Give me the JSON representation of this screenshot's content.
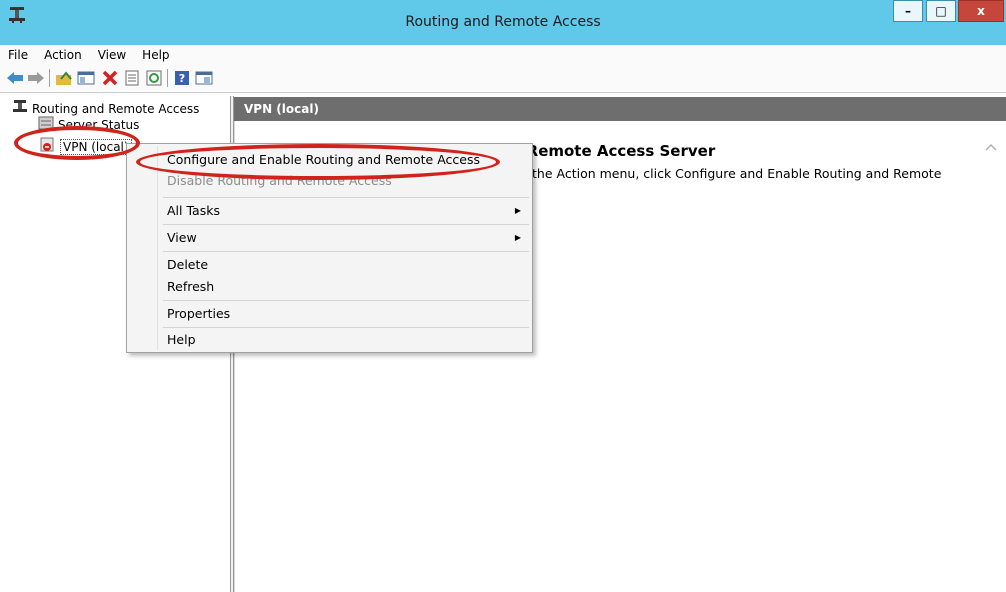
{
  "window": {
    "title": "Routing and Remote Access",
    "controls": {
      "minimize": "–",
      "maximize": "□",
      "close": "x"
    }
  },
  "menubar": {
    "items": [
      "File",
      "Action",
      "View",
      "Help"
    ]
  },
  "toolbar": {
    "icons": [
      "back-icon",
      "forward-icon",
      "up-folder-icon",
      "show-hide-tree-icon",
      "delete-icon",
      "properties-icon",
      "refresh-icon",
      "help-icon",
      "console-icon"
    ]
  },
  "tree": {
    "root": "Routing and Remote Access",
    "items": [
      "Server Status",
      "VPN (local)"
    ]
  },
  "content": {
    "header": "VPN (local)",
    "heading_partial": "nd Remote Access Server",
    "text_partial": "the Action menu, click Configure and Enable Routing and Remote"
  },
  "context_menu": {
    "items": [
      {
        "label": "Configure and Enable Routing and Remote Access",
        "enabled": true
      },
      {
        "label": "Disable Routing and Remote Access",
        "enabled": false
      },
      {
        "label": "All Tasks",
        "submenu": true
      },
      {
        "label": "View",
        "submenu": true
      },
      {
        "label": "Delete"
      },
      {
        "label": "Refresh"
      },
      {
        "label": "Properties"
      },
      {
        "label": "Help"
      }
    ]
  },
  "colors": {
    "titlebar": "#60c9ea",
    "highlight": "#d0231c",
    "pane_header": "#6e6e6e"
  }
}
